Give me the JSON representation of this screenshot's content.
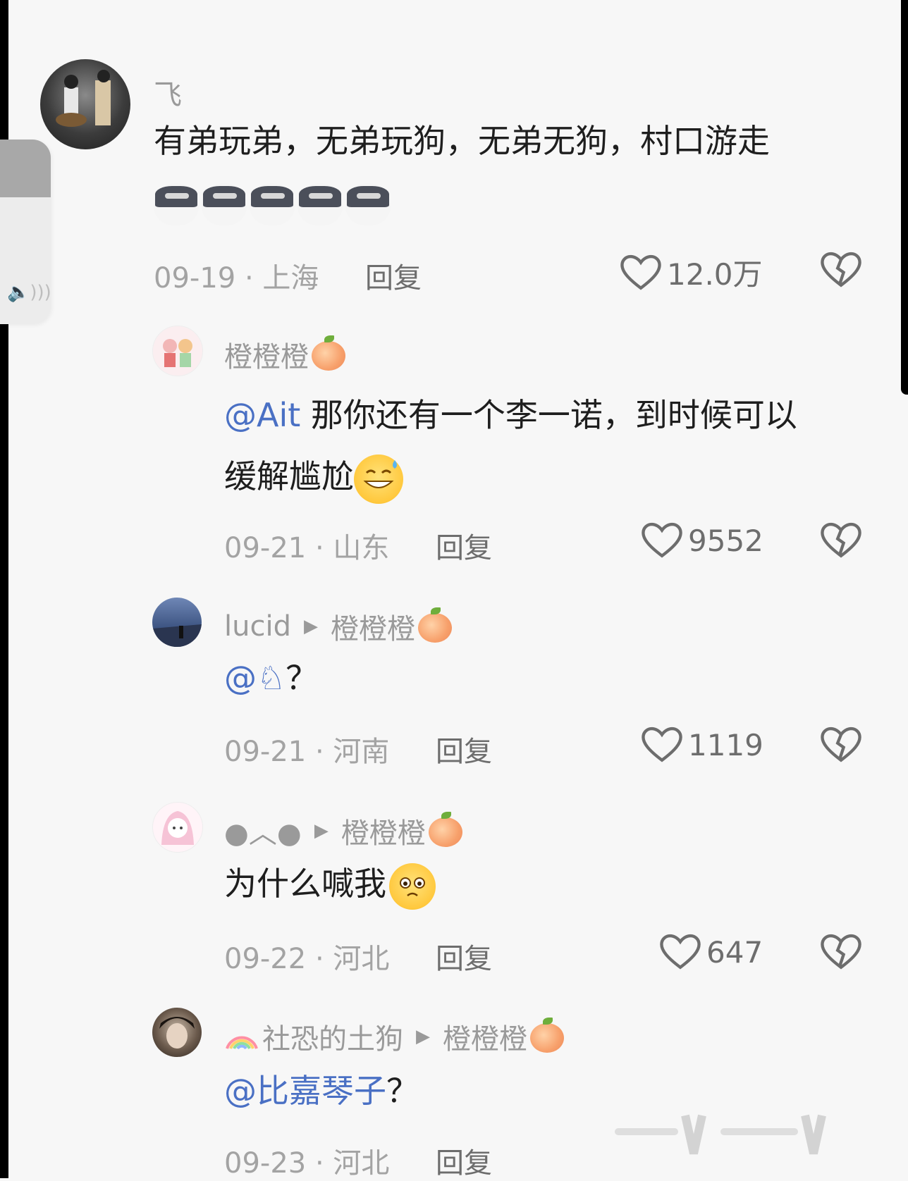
{
  "comments": [
    {
      "name": "飞",
      "text": "有弟玩弟，无弟玩狗，无弟无狗，村口游走",
      "date": "09-19",
      "location": "上海",
      "reply": "回复",
      "likes": "12.0万"
    },
    {
      "name": "橙橙橙",
      "mention": "@Ait",
      "text_line1": "那你还有一个李一诺，到时候可以",
      "text_line2": "缓解尴尬",
      "date": "09-21",
      "location": "山东",
      "reply": "回复",
      "likes": "9552"
    },
    {
      "name": "lucid",
      "reply_to": "橙橙橙",
      "mention": "@♘",
      "text": "？",
      "date": "09-21",
      "location": "河南",
      "reply": "回复",
      "likes": "1119"
    },
    {
      "name": "●︿●",
      "reply_to": "橙橙橙",
      "text": "为什么喊我",
      "date": "09-22",
      "location": "河北",
      "reply": "回复",
      "likes": "647"
    },
    {
      "name": "社恐的土狗",
      "reply_to": "橙橙橙",
      "mention": "@比嘉琴子",
      "text": "？",
      "date": "09-23",
      "location": "河北",
      "reply": "回复"
    }
  ],
  "separator": "·",
  "colors": {
    "mention": "#4a70c4",
    "meta": "#a3a3a3",
    "text": "#1e1e1e"
  }
}
